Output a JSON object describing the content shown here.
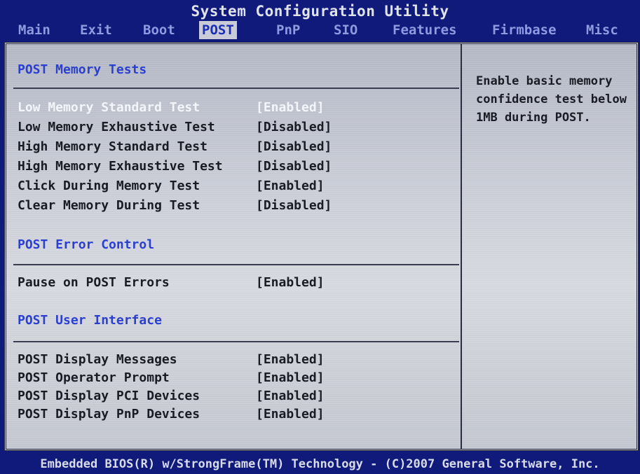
{
  "title": "System Configuration Utility",
  "menu": [
    {
      "label": "Main",
      "active": false
    },
    {
      "label": "Exit",
      "active": false
    },
    {
      "label": "Boot",
      "active": false
    },
    {
      "label": "POST",
      "active": true
    },
    {
      "label": "PnP",
      "active": false
    },
    {
      "label": "SIO",
      "active": false
    },
    {
      "label": "Features",
      "active": false
    },
    {
      "label": "Firmbase",
      "active": false
    },
    {
      "label": "Misc",
      "active": false
    }
  ],
  "sections": {
    "memory_tests": {
      "title": "POST Memory Tests",
      "items": [
        {
          "label": "Low Memory Standard Test",
          "value": "[Enabled]",
          "selected": true
        },
        {
          "label": "Low Memory Exhaustive Test",
          "value": "[Disabled]"
        },
        {
          "label": "High Memory Standard Test",
          "value": "[Disabled]"
        },
        {
          "label": "High Memory Exhaustive Test",
          "value": "[Disabled]"
        },
        {
          "label": "Click During Memory Test",
          "value": "[Enabled]"
        },
        {
          "label": "Clear Memory During Test",
          "value": "[Disabled]"
        }
      ]
    },
    "error_control": {
      "title": "POST Error Control",
      "items": [
        {
          "label": "Pause on POST Errors",
          "value": "[Enabled]"
        }
      ]
    },
    "user_interface": {
      "title": "POST User Interface",
      "items": [
        {
          "label": "POST Display Messages",
          "value": "[Enabled]"
        },
        {
          "label": "POST Operator Prompt",
          "value": "[Enabled]"
        },
        {
          "label": "POST Display PCI Devices",
          "value": "[Enabled]"
        },
        {
          "label": "POST Display PnP Devices",
          "value": "[Enabled]"
        }
      ]
    }
  },
  "help": {
    "lines": [
      "Enable basic memory",
      "confidence test below",
      "1MB during POST."
    ]
  },
  "footer": "Embedded BIOS(R) w/StrongFrame(TM) Technology - (C)2007 General Software, Inc.",
  "colors": {
    "background": "#101a7a",
    "panel": "#c9ccd6",
    "section_heading": "#2b3fd0",
    "selected_text": "#f4f5fb"
  }
}
